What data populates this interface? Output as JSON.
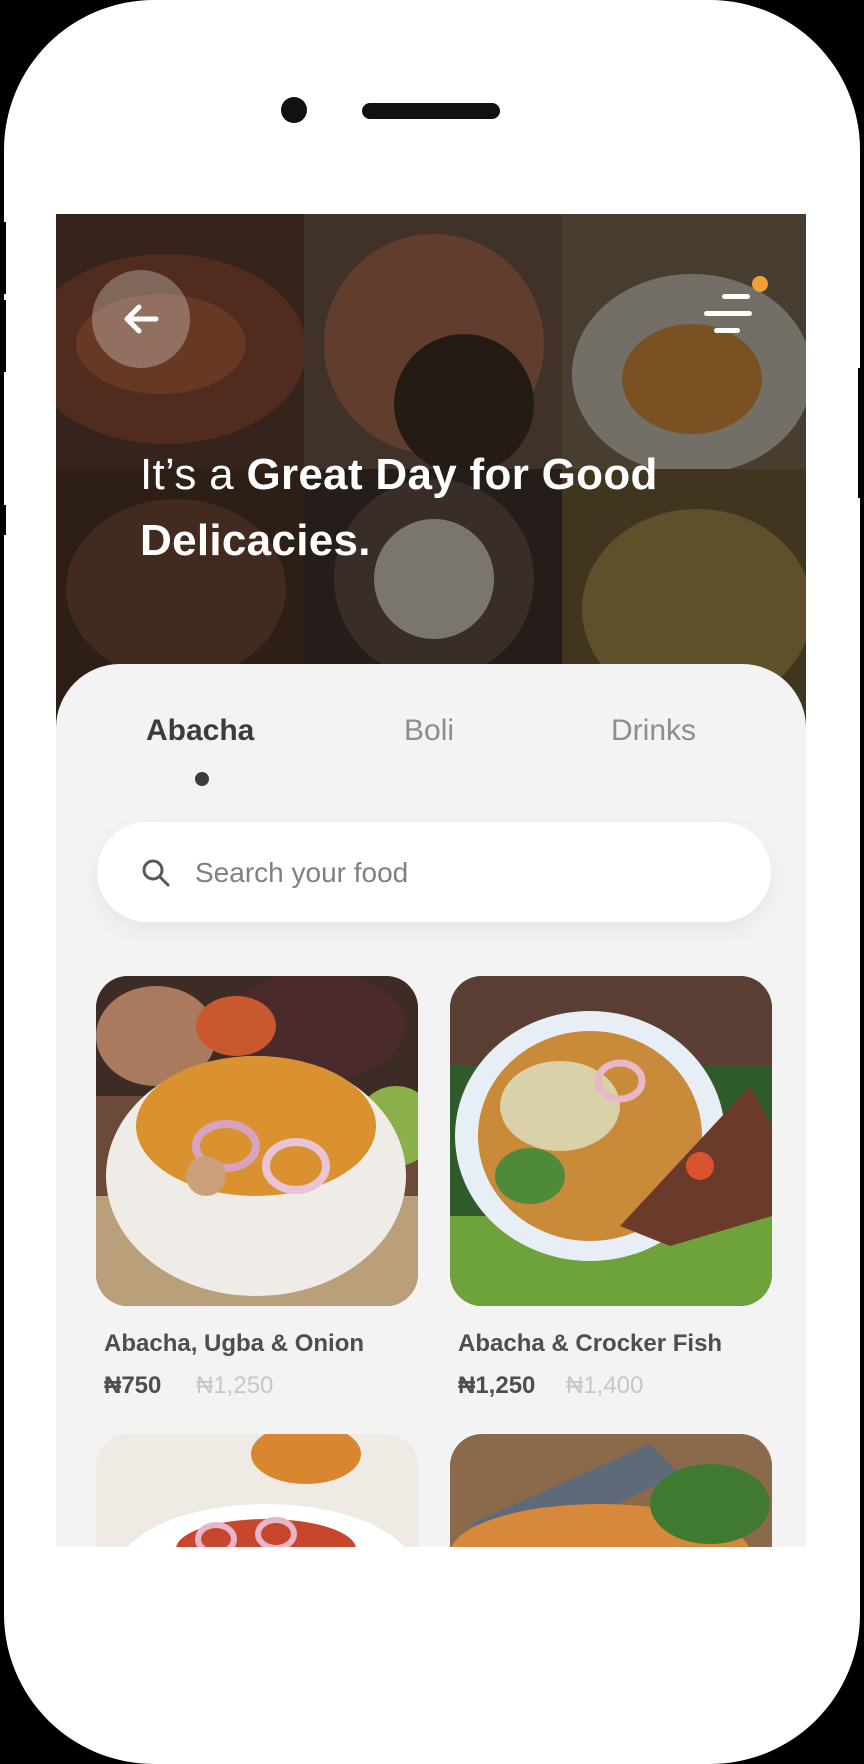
{
  "header": {
    "headline_light": "It’s a ",
    "headline_bold": "Great Day for Good Delicacies.",
    "back_icon": "arrow-left-icon",
    "menu_icon": "menu-lines-icon",
    "notification_color": "#f0a037"
  },
  "tabs": [
    {
      "label": "Abacha",
      "active": true
    },
    {
      "label": "Boli",
      "active": false
    },
    {
      "label": "Drinks",
      "active": false
    }
  ],
  "search": {
    "placeholder": "Search your food",
    "icon": "search-icon"
  },
  "products": [
    {
      "name": "Abacha, Ugba & Onion",
      "price": "₦750",
      "old_price": "₦1,250"
    },
    {
      "name": "Abacha & Crocker Fish",
      "price": "₦1,250",
      "old_price": "₦1,400"
    }
  ],
  "colors": {
    "screen_bg": "#f4f3f4",
    "accent": "#f0a037",
    "text_dark": "#3c3c3c",
    "text_muted": "#8d8d8d"
  }
}
